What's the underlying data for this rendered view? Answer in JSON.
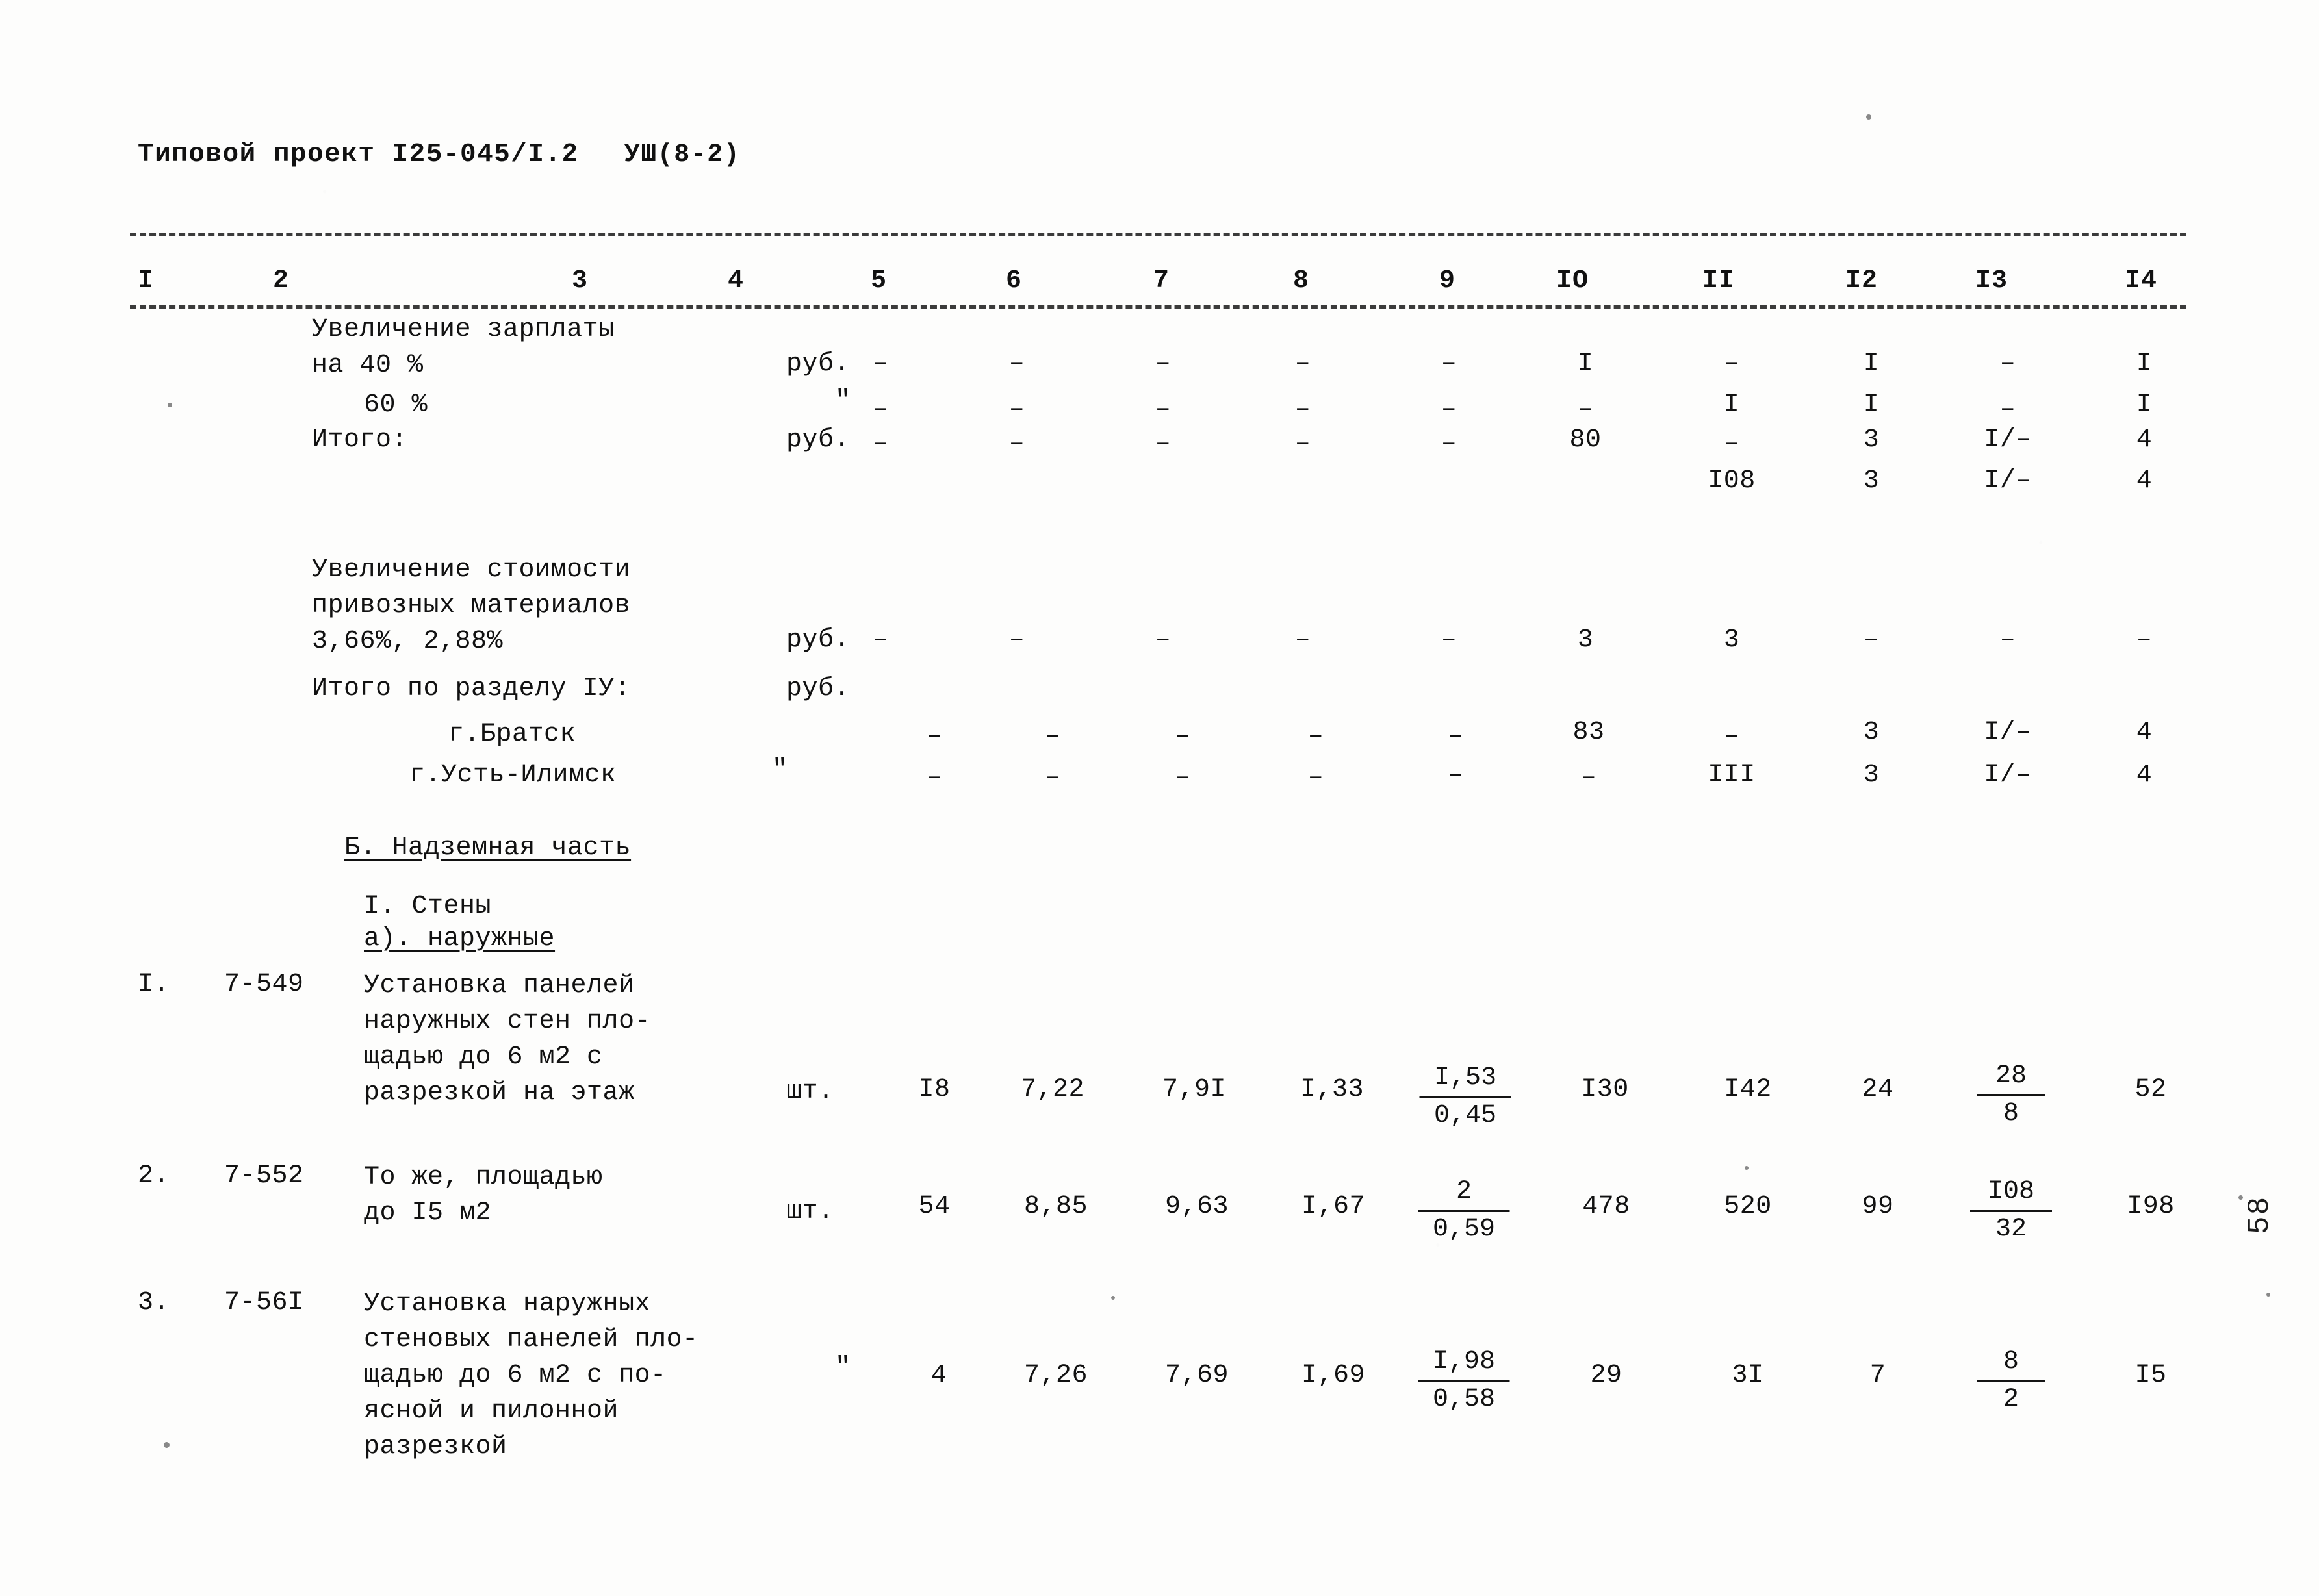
{
  "header": {
    "title": "Типовой проект I25-045/I.2",
    "sheet_code": "УШ(8-2)"
  },
  "table": {
    "column_numbers": [
      "I",
      "2",
      "3",
      "4",
      "5",
      "6",
      "7",
      "8",
      "9",
      "IO",
      "II",
      "I2",
      "I3",
      "I4"
    ],
    "rows": [
      {
        "id": "row-uvelichenie-zarplaty-40",
        "num": "",
        "code": "",
        "description": "Увеличение зарплаты\nна 40 %",
        "unit": "руб.",
        "c5": "–",
        "c6": "–",
        "c7": "–",
        "c8": "–",
        "c9": "–",
        "c10": "I",
        "c11": "–",
        "c12": "I",
        "c13": "–",
        "c14": "I"
      },
      {
        "id": "row-uvelichenie-zarplaty-60",
        "num": "",
        "code": "",
        "description": "60 %",
        "unit": "\"",
        "c5": "–",
        "c6": "–",
        "c7": "–",
        "c8": "–",
        "c9": "–",
        "c10": "–",
        "c11": "I",
        "c12": "I",
        "c13": "–",
        "c14": "I"
      },
      {
        "id": "row-itogo",
        "num": "",
        "code": "",
        "description": "Итого:",
        "unit": "руб.",
        "c5": "–",
        "c6": "–",
        "c7": "–",
        "c8": "–",
        "c9": "–",
        "c10": "80",
        "c11": "–",
        "c12": "3",
        "c13": "I/–",
        "c14": "4"
      },
      {
        "id": "row-itogo-second",
        "num": "",
        "code": "",
        "description": "",
        "unit": "",
        "c5": "",
        "c6": "",
        "c7": "",
        "c8": "",
        "c9": "",
        "c10": "",
        "c11": "I08",
        "c12": "3",
        "c13": "I/–",
        "c14": "4"
      },
      {
        "id": "row-uvelichenie-stoimosti",
        "num": "",
        "code": "",
        "description": "Увеличение стоимости\nпривозных материалов\n3,66%, 2,88%",
        "unit": "руб.",
        "c5": "–",
        "c6": "–",
        "c7": "–",
        "c8": "–",
        "c9": "–",
        "c10": "3",
        "c11": "3",
        "c12": "–",
        "c13": "–",
        "c14": "–"
      },
      {
        "id": "row-itogo-po-razdelu",
        "num": "",
        "code": "",
        "description": "Итого по разделу IУ:",
        "unit": "руб.",
        "c5": "",
        "c6": "",
        "c7": "",
        "c8": "",
        "c9": "",
        "c10": "",
        "c11": "",
        "c12": "",
        "c13": "",
        "c14": ""
      },
      {
        "id": "row-bratsk",
        "num": "",
        "code": "",
        "description": "г.Братск",
        "unit": "",
        "c5": "–",
        "c6": "–",
        "c7": "–",
        "c8": "–",
        "c9": "–",
        "c10": "83",
        "c11": "–",
        "c12": "3",
        "c13": "I/–",
        "c14": "4"
      },
      {
        "id": "row-ust-ilimsk",
        "num": "",
        "code": "",
        "description": "г.Усть-Илимск",
        "unit": "\"",
        "c5": "–",
        "c6": "–",
        "c7": "–",
        "c8": "–",
        "c9": "–",
        "c10": "–",
        "c11": "III",
        "c12": "3",
        "c13": "I/–",
        "c14": "4"
      },
      {
        "id": "row-item-1",
        "num": "I.",
        "code": "7-549",
        "description": "Установка панелей\nнаружных стен пло-\nщадью до 6 м2 с\nразрезкой на этаж",
        "unit": "шт.",
        "c5": "I8",
        "c6": "7,22",
        "c7": "7,9I",
        "c8": "I,33",
        "c9_top": "I,53",
        "c9_bot": "0,45",
        "c10": "I30",
        "c11": "I42",
        "c12": "24",
        "c13_top": "28",
        "c13_bot": "8",
        "c14": "52"
      },
      {
        "id": "row-item-2",
        "num": "2.",
        "code": "7-552",
        "description": "То же, площадью\nдо I5 м2",
        "unit": "шт.",
        "c5": "54",
        "c6": "8,85",
        "c7": "9,63",
        "c8": "I,67",
        "c9_top": "2",
        "c9_bot": "0,59",
        "c10": "478",
        "c11": "520",
        "c12": "99",
        "c13_top": "I08",
        "c13_bot": "32",
        "c14": "I98"
      },
      {
        "id": "row-item-3",
        "num": "3.",
        "code": "7-56I",
        "description": "Установка наружных\nстеновых панелей пло-\nщадью до 6 м2 с по-\nясной и пилонной\nразрезкой",
        "unit": "\"",
        "c5": "4",
        "c6": "7,26",
        "c7": "7,69",
        "c8": "I,69",
        "c9_top": "I,98",
        "c9_bot": "0,58",
        "c10": "29",
        "c11": "3I",
        "c12": "7",
        "c13_top": "8",
        "c13_bot": "2",
        "c14": "I5"
      }
    ],
    "section_headings": {
      "part_b": "Б. Надземная часть",
      "sub_1": "I. Стены",
      "sub_1a": "а). наружные"
    }
  },
  "page_number": "58"
}
